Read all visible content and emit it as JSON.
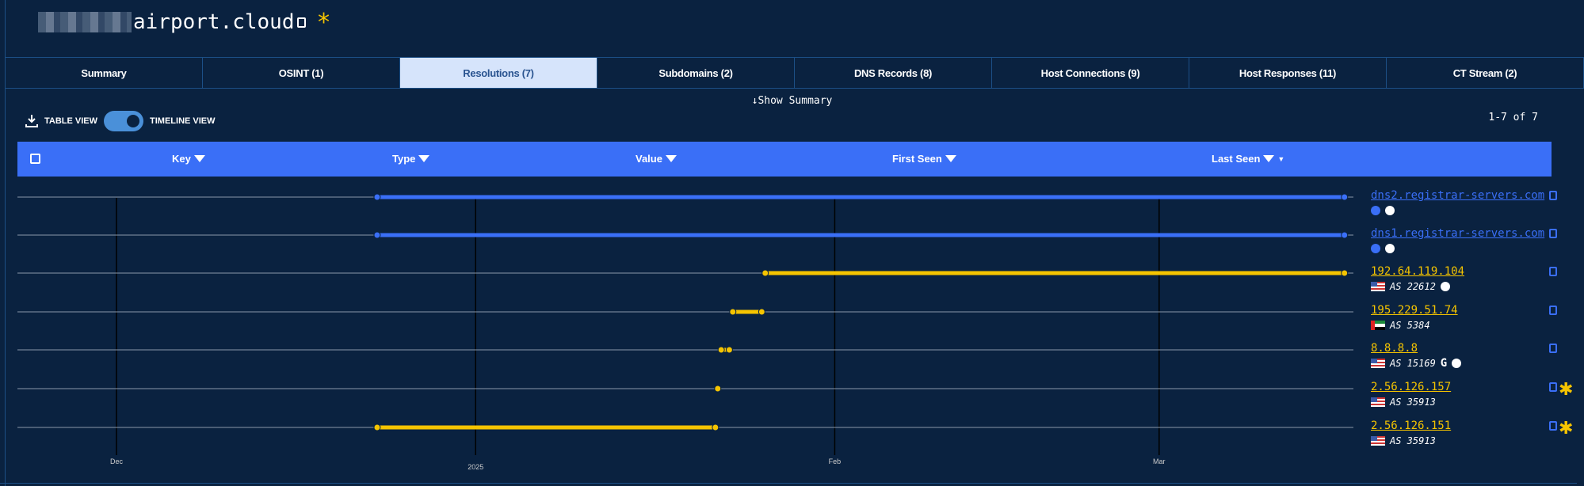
{
  "title": {
    "domain": "airport.cloud",
    "star": "*"
  },
  "tabs": [
    {
      "label": "Summary"
    },
    {
      "label": "OSINT (1)"
    },
    {
      "label": "Resolutions (7)",
      "active": true
    },
    {
      "label": "Subdomains (2)"
    },
    {
      "label": "DNS Records (8)"
    },
    {
      "label": "Host Connections (9)"
    },
    {
      "label": "Host Responses (11)"
    },
    {
      "label": "CT Stream (2)"
    }
  ],
  "show_summary": "↓Show Summary",
  "toolbar": {
    "table_view": "TABLE VIEW",
    "timeline_view": "TIMELINE VIEW",
    "toggle_on": true
  },
  "pager": "1-7 of 7",
  "columns": {
    "key": "Key",
    "type": "Type",
    "value": "Value",
    "first_seen": "First Seen",
    "last_seen": "Last Seen"
  },
  "colors": {
    "domain": "#3a6ff7",
    "ip": "#f5c400",
    "star": "#f5c400"
  },
  "chart_data": {
    "type": "timeline",
    "x_unit": "days since Dec 1 2024",
    "xlim": [
      -7,
      107
    ],
    "ticks": [
      {
        "label": "Dec",
        "day": 0
      },
      {
        "label": "2025",
        "day": 31
      },
      {
        "label": "Feb",
        "day": 62
      },
      {
        "label": "Mar",
        "day": 90
      }
    ],
    "rows": [
      {
        "value": "dns2.registrar-servers.com",
        "kind": "domain",
        "start": 22.5,
        "end": 106,
        "icons": [
          "blue-flame",
          "white-flame"
        ]
      },
      {
        "value": "dns1.registrar-servers.com",
        "kind": "domain",
        "start": 22.5,
        "end": 106,
        "icons": [
          "blue-flame",
          "white-flame"
        ]
      },
      {
        "value": "192.64.119.104",
        "kind": "ip",
        "start": 56,
        "end": 106,
        "flag": "us",
        "asn": "AS 22612",
        "icons": [
          "white-flame"
        ]
      },
      {
        "value": "195.229.51.74",
        "kind": "ip",
        "start": 53.2,
        "end": 55.7,
        "flag": "ae",
        "asn": "AS 5384",
        "icons": []
      },
      {
        "value": "8.8.8.8",
        "kind": "ip",
        "start": 52.2,
        "end": 52.9,
        "flag": "us",
        "asn": "AS 15169",
        "icons": [
          "google",
          "white-flame"
        ]
      },
      {
        "value": "2.56.126.157",
        "kind": "ip",
        "start": 51.9,
        "end": 51.9,
        "flag": "us",
        "asn": "AS 35913",
        "icons": [],
        "starred": true
      },
      {
        "value": "2.56.126.151",
        "kind": "ip",
        "start": 22.5,
        "end": 51.7,
        "flag": "us",
        "asn": "AS 35913",
        "icons": [],
        "starred": true
      }
    ]
  }
}
